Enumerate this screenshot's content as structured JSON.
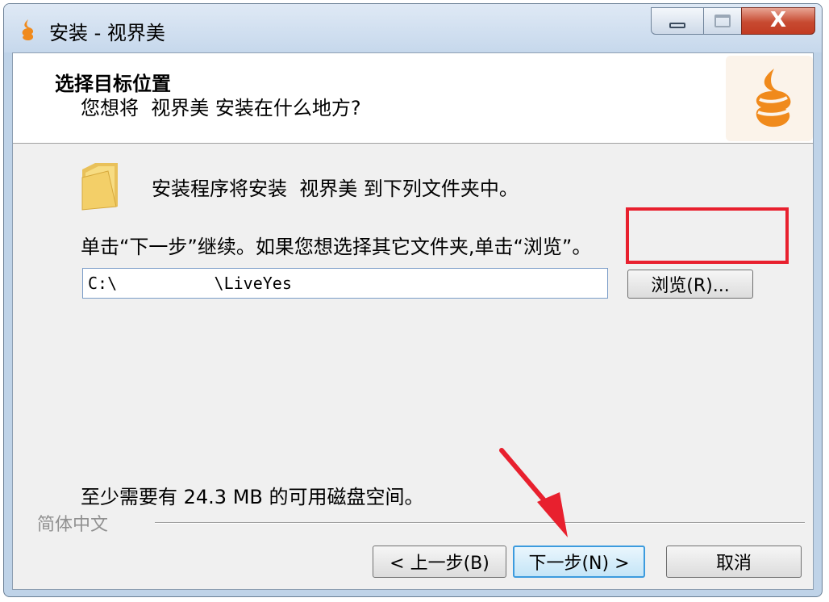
{
  "window": {
    "title": "安装 - 视界美",
    "controls": {
      "minimize": "minimize",
      "maximize": "maximize",
      "close": "X"
    }
  },
  "header": {
    "title": "选择目标位置",
    "subtitle": "您想将  视界美 安装在什么地方?",
    "logo_icon": "flame-logo-icon"
  },
  "body": {
    "folder_icon": "folder-icon",
    "info_text": "安装程序将安装  视界美 到下列文件夹中。",
    "instruction": "单击“下一步”继续。如果您想选择其它文件夹,单击“浏览”。",
    "path_value": "C:\\          \\LiveYes",
    "browse_label": "浏览(R)...",
    "disk_space": "至少需要有 24.3 MB 的可用磁盘空间。"
  },
  "footer": {
    "language": "简体中文",
    "back_label": "< 上一步(B)",
    "next_label": "下一步(N) >",
    "cancel_label": "取消"
  },
  "colors": {
    "accent_red": "#e8202e",
    "logo_orange": "#f08a1c",
    "default_button_border": "#3c9bde"
  }
}
